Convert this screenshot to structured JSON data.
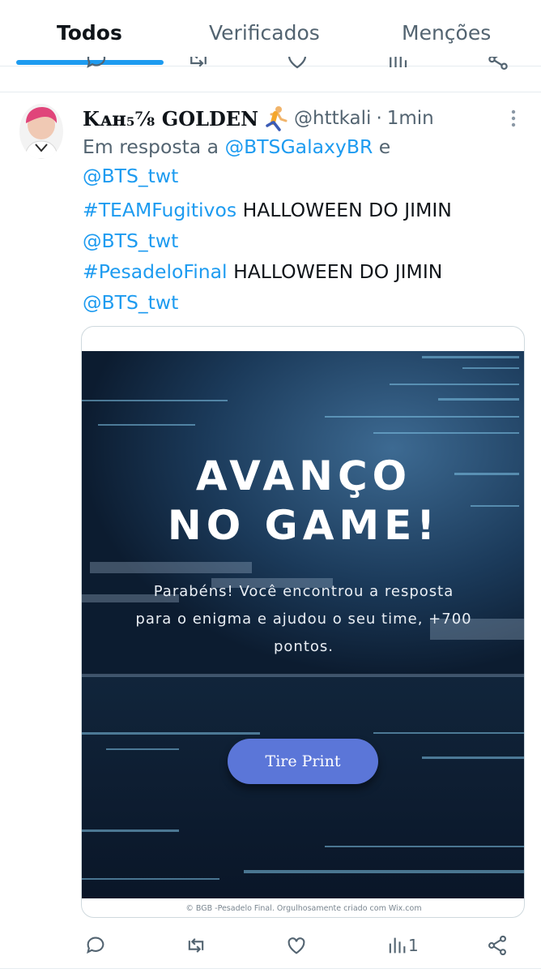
{
  "tabs": [
    {
      "label": "Todos",
      "active": true
    },
    {
      "label": "Verificados",
      "active": false
    },
    {
      "label": "Menções",
      "active": false
    }
  ],
  "tweet": {
    "display_name": "Kᴀн₅⁷⁄₈ GOLDEN",
    "handle": "@httkali",
    "separator": "·",
    "time": "1min",
    "reply_prefix": "Em resposta a",
    "reply_to_1": "@BTSGalaxyBR",
    "reply_and": "e",
    "reply_to_2": "@BTS_twt",
    "lines": [
      {
        "hashtag": "#TEAMFugitivos",
        "text": "HALLOWEEN DO JIMIN"
      },
      {
        "mention": "@BTS_twt"
      },
      {
        "hashtag": "#PesadeloFinal",
        "text": "HALLOWEEN DO JIMIN"
      },
      {
        "mention": "@BTS_twt"
      }
    ],
    "views_count": "1"
  },
  "media": {
    "title_line1": "AVANÇO",
    "title_line2": "NO GAME!",
    "message_line1": "Parabéns! Você encontrou a resposta",
    "message_line2": "para o enigma e ajudou o seu time, +700",
    "message_line3": "pontos.",
    "button_label": "Tire Print",
    "footer": "© BGB -Pesadelo Final. Orgulhosamente criado com Wix.com"
  },
  "colors": {
    "accent": "#1d9bf0",
    "muted": "#536471",
    "button": "#5b76d8",
    "image_bg": "#0f2238"
  },
  "icons": [
    "reply-icon",
    "retweet-icon",
    "like-icon",
    "views-icon",
    "share-icon",
    "more-icon"
  ]
}
